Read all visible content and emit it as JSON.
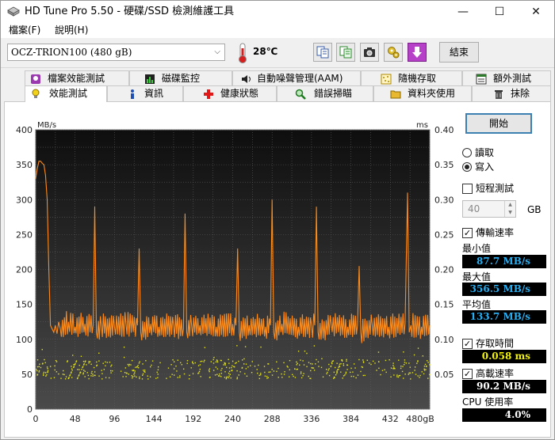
{
  "window": {
    "title": "HD Tune Pro 5.50 - 硬碟/SSD 檢測維護工具",
    "minimize": "—",
    "maximize": "☐",
    "close": "✕"
  },
  "menu": {
    "file": "檔案(F)",
    "help": "說明(H)"
  },
  "toolbar": {
    "drive": "OCZ-TRION100 (480 gB)",
    "temperature": "28℃",
    "exit": "結束"
  },
  "tabs_top": [
    {
      "label": "檔案效能測試",
      "icon": "file-benchmark-icon"
    },
    {
      "label": "磁碟監控",
      "icon": "disk-monitor-icon"
    },
    {
      "label": "自動噪聲管理(AAM)",
      "icon": "speaker-icon"
    },
    {
      "label": "隨機存取",
      "icon": "random-access-icon"
    },
    {
      "label": "額外測試",
      "icon": "extra-tests-icon"
    }
  ],
  "tabs_bottom": [
    {
      "label": "效能測試",
      "icon": "lightbulb-icon",
      "active": true
    },
    {
      "label": "資訊",
      "icon": "info-icon"
    },
    {
      "label": "健康狀態",
      "icon": "health-cross-icon"
    },
    {
      "label": "錯誤掃瞄",
      "icon": "magnifier-icon"
    },
    {
      "label": "資料夾使用",
      "icon": "folder-icon"
    },
    {
      "label": "抹除",
      "icon": "trash-icon"
    }
  ],
  "controls": {
    "start": "開始",
    "read": "讀取",
    "write": "寫入",
    "mode_selected": "write",
    "short_test": "短程測試",
    "short_test_checked": false,
    "short_size": "40",
    "short_unit": "GB",
    "transfer_rate": "傳輸速率",
    "transfer_rate_checked": true,
    "min_label": "最小值",
    "min_value": "87.7 MB/s",
    "max_label": "最大值",
    "max_value": "356.5 MB/s",
    "avg_label": "平均值",
    "avg_value": "133.7 MB/s",
    "access_time": "存取時間",
    "access_time_checked": true,
    "access_value": "0.058 ms",
    "burst_rate": "高載速率",
    "burst_rate_checked": true,
    "burst_value": "90.2 MB/s",
    "cpu_label": "CPU 使用率",
    "cpu_value": "4.0%"
  },
  "colors": {
    "transfer_line": "#ff8c1a",
    "access_dots": "#e6e619",
    "plot_bg_top": "#0e0e0e",
    "plot_bg_bottom": "#4a4a4a",
    "value_blue": "#28aef0"
  },
  "chart_data": {
    "type": "line",
    "left_unit": "MB/s",
    "right_unit": "ms",
    "x_ticks": [
      "0",
      "48",
      "96",
      "144",
      "192",
      "240",
      "288",
      "336",
      "384",
      "432",
      "480gB"
    ],
    "y_ticks_left": [
      "0",
      "50",
      "100",
      "150",
      "200",
      "250",
      "300",
      "350",
      "400"
    ],
    "y_ticks_right": [
      "",
      "0.05",
      "0.10",
      "0.15",
      "0.20",
      "0.25",
      "0.30",
      "0.35",
      "0.40"
    ],
    "xlim": [
      0,
      480
    ],
    "ylim_left": [
      0,
      400
    ],
    "ylim_right": [
      0,
      0.4
    ],
    "grid": true,
    "series": [
      {
        "name": "傳輸速率",
        "x": [
          0,
          2,
          4,
          6,
          8,
          10,
          12,
          14,
          16,
          18,
          20,
          22,
          24,
          26,
          28,
          30,
          40,
          48,
          60,
          70,
          72,
          74,
          80,
          96,
          110,
          124,
          126,
          128,
          140,
          150,
          168,
          180,
          182,
          184,
          190,
          200,
          220,
          240,
          244,
          246,
          248,
          260,
          280,
          286,
          288,
          290,
          300,
          320,
          336,
          340,
          342,
          344,
          360,
          380,
          392,
          394,
          396,
          410,
          430,
          450,
          453,
          455,
          457,
          470,
          480
        ],
        "y": [
          330,
          345,
          355,
          355,
          352,
          350,
          335,
          300,
          200,
          120,
          115,
          110,
          120,
          108,
          125,
          115,
          125,
          118,
          122,
          120,
          290,
          110,
          120,
          118,
          122,
          120,
          230,
          110,
          122,
          118,
          120,
          115,
          280,
          110,
          120,
          120,
          118,
          122,
          120,
          230,
          110,
          120,
          118,
          120,
          300,
          110,
          122,
          118,
          120,
          120,
          290,
          110,
          122,
          118,
          120,
          205,
          110,
          120,
          118,
          122,
          310,
          110,
          120,
          118,
          120
        ]
      },
      {
        "name": "存取時間",
        "x": [
          0,
          480
        ],
        "y": [
          0.058,
          0.058
        ]
      }
    ]
  }
}
